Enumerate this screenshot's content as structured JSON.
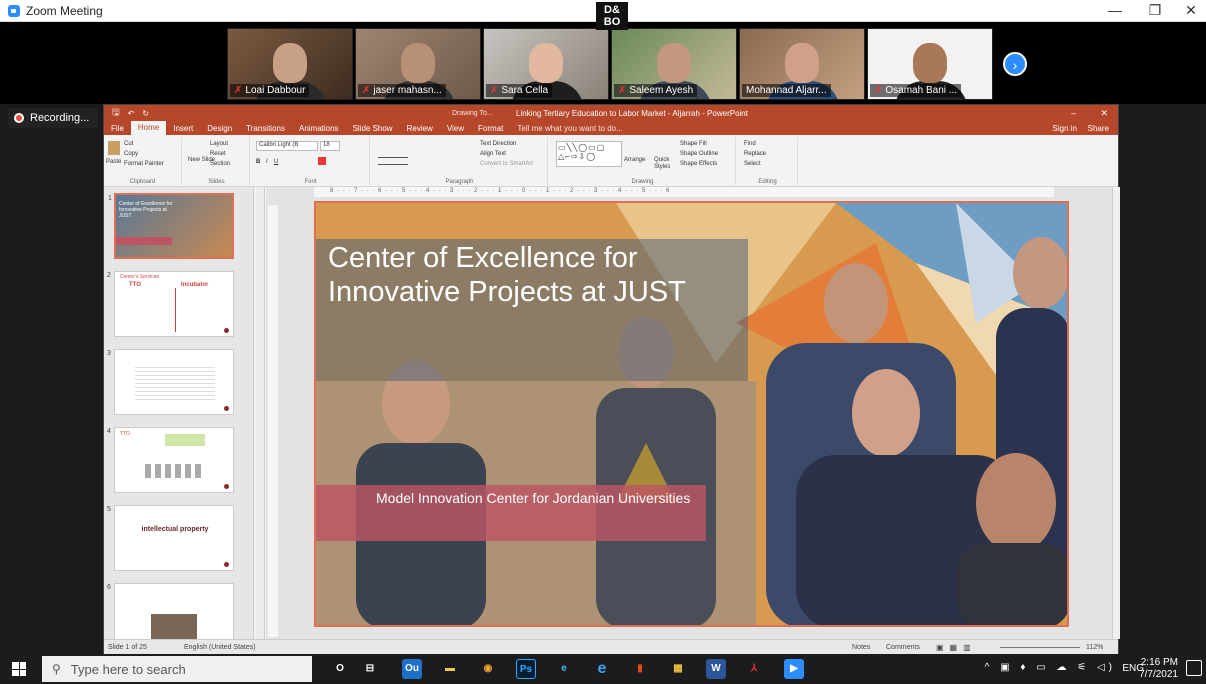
{
  "zoom": {
    "window_title": "Zoom Meeting",
    "minimize": "—",
    "restore": "❐",
    "close": "✕",
    "recording_label": "Recording...",
    "next_icon": "›",
    "participants": [
      {
        "name": "Loai Dabbour"
      },
      {
        "name": "jaser mahasn..."
      },
      {
        "name": "Sara Cella"
      },
      {
        "name": "Saleem Ayesh"
      },
      {
        "name": "Mohannad Aljarr..."
      },
      {
        "name": "Osamah Bani ..."
      }
    ],
    "active_speaker_logo": "D&\nBO"
  },
  "ppt": {
    "title": "Linking Tertiary Education to Labor Market - Aljarrah - PowerPoint",
    "drawing_tools": "Drawing To...",
    "sign_in": "Sign in",
    "share": "Share",
    "tabs": [
      "File",
      "Home",
      "Insert",
      "Design",
      "Transitions",
      "Animations",
      "Slide Show",
      "Review",
      "View",
      "Format"
    ],
    "tell_me": "Tell me what you want to do...",
    "ribbon": {
      "clipboard": {
        "label": "Clipboard",
        "paste": "Paste",
        "cut": "Cut",
        "copy": "Copy",
        "format_painter": "Format Painter"
      },
      "slides": {
        "label": "Slides",
        "new_slide": "New Slide",
        "layout": "Layout",
        "reset": "Reset",
        "section": "Section"
      },
      "font": {
        "label": "Font",
        "font_name": "Calibri Light (B",
        "font_size": "18"
      },
      "paragraph": {
        "label": "Paragraph",
        "text_direction": "Text Direction",
        "align_text": "Align Text",
        "smartart": "Convert to SmartArt"
      },
      "drawing": {
        "label": "Drawing",
        "arrange": "Arrange",
        "quick_styles": "Quick Styles",
        "shape_fill": "Shape Fill",
        "shape_outline": "Shape Outline",
        "shape_effects": "Shape Effects"
      },
      "editing": {
        "label": "Editing",
        "find": "Find",
        "replace": "Replace",
        "select": "Select"
      }
    },
    "thumbs": [
      {
        "num": "1",
        "text": "Center of Excellence for Innovative Projects at JUST"
      },
      {
        "num": "2",
        "text": "Center's Services"
      },
      {
        "num": "3",
        "text": ""
      },
      {
        "num": "4",
        "text": "TTO"
      },
      {
        "num": "5",
        "text": "intellectual property"
      },
      {
        "num": "6",
        "text": ""
      }
    ],
    "thumb2": {
      "tto": "TTO",
      "incubator": "Incubator"
    },
    "slide": {
      "title": "Center of Excellence for Innovative Projects at JUST",
      "subtitle": "Model Innovation Center for Jordanian Universities"
    },
    "ruler": "8 · · · 7 · · · 6 · · · 5 · · · 4 · · · 3 · · · 2 · · · 1 · · · 0 · · · 1 · · · 2 · · · 3 · · · 4 · · · 5 · · · 6",
    "status": {
      "slide_count": "Slide 1 of 25",
      "language": "English (United States)",
      "notes": "Notes",
      "comments": "Comments",
      "zoom": "112%"
    }
  },
  "taskbar": {
    "search_placeholder": "Type here to search",
    "apps": [
      "O",
      "⊟",
      "Ou",
      "▬",
      "◉",
      "Ps",
      "e",
      "e",
      "▮",
      "▦",
      "W",
      "⅄",
      "▶"
    ],
    "language": "ENG",
    "time": "2:16 PM",
    "date": "7/7/2021"
  },
  "colors": {
    "ppt_accent": "#b7472a",
    "zoom_blue": "#2d8cff",
    "slide_band": "#bc5664"
  }
}
